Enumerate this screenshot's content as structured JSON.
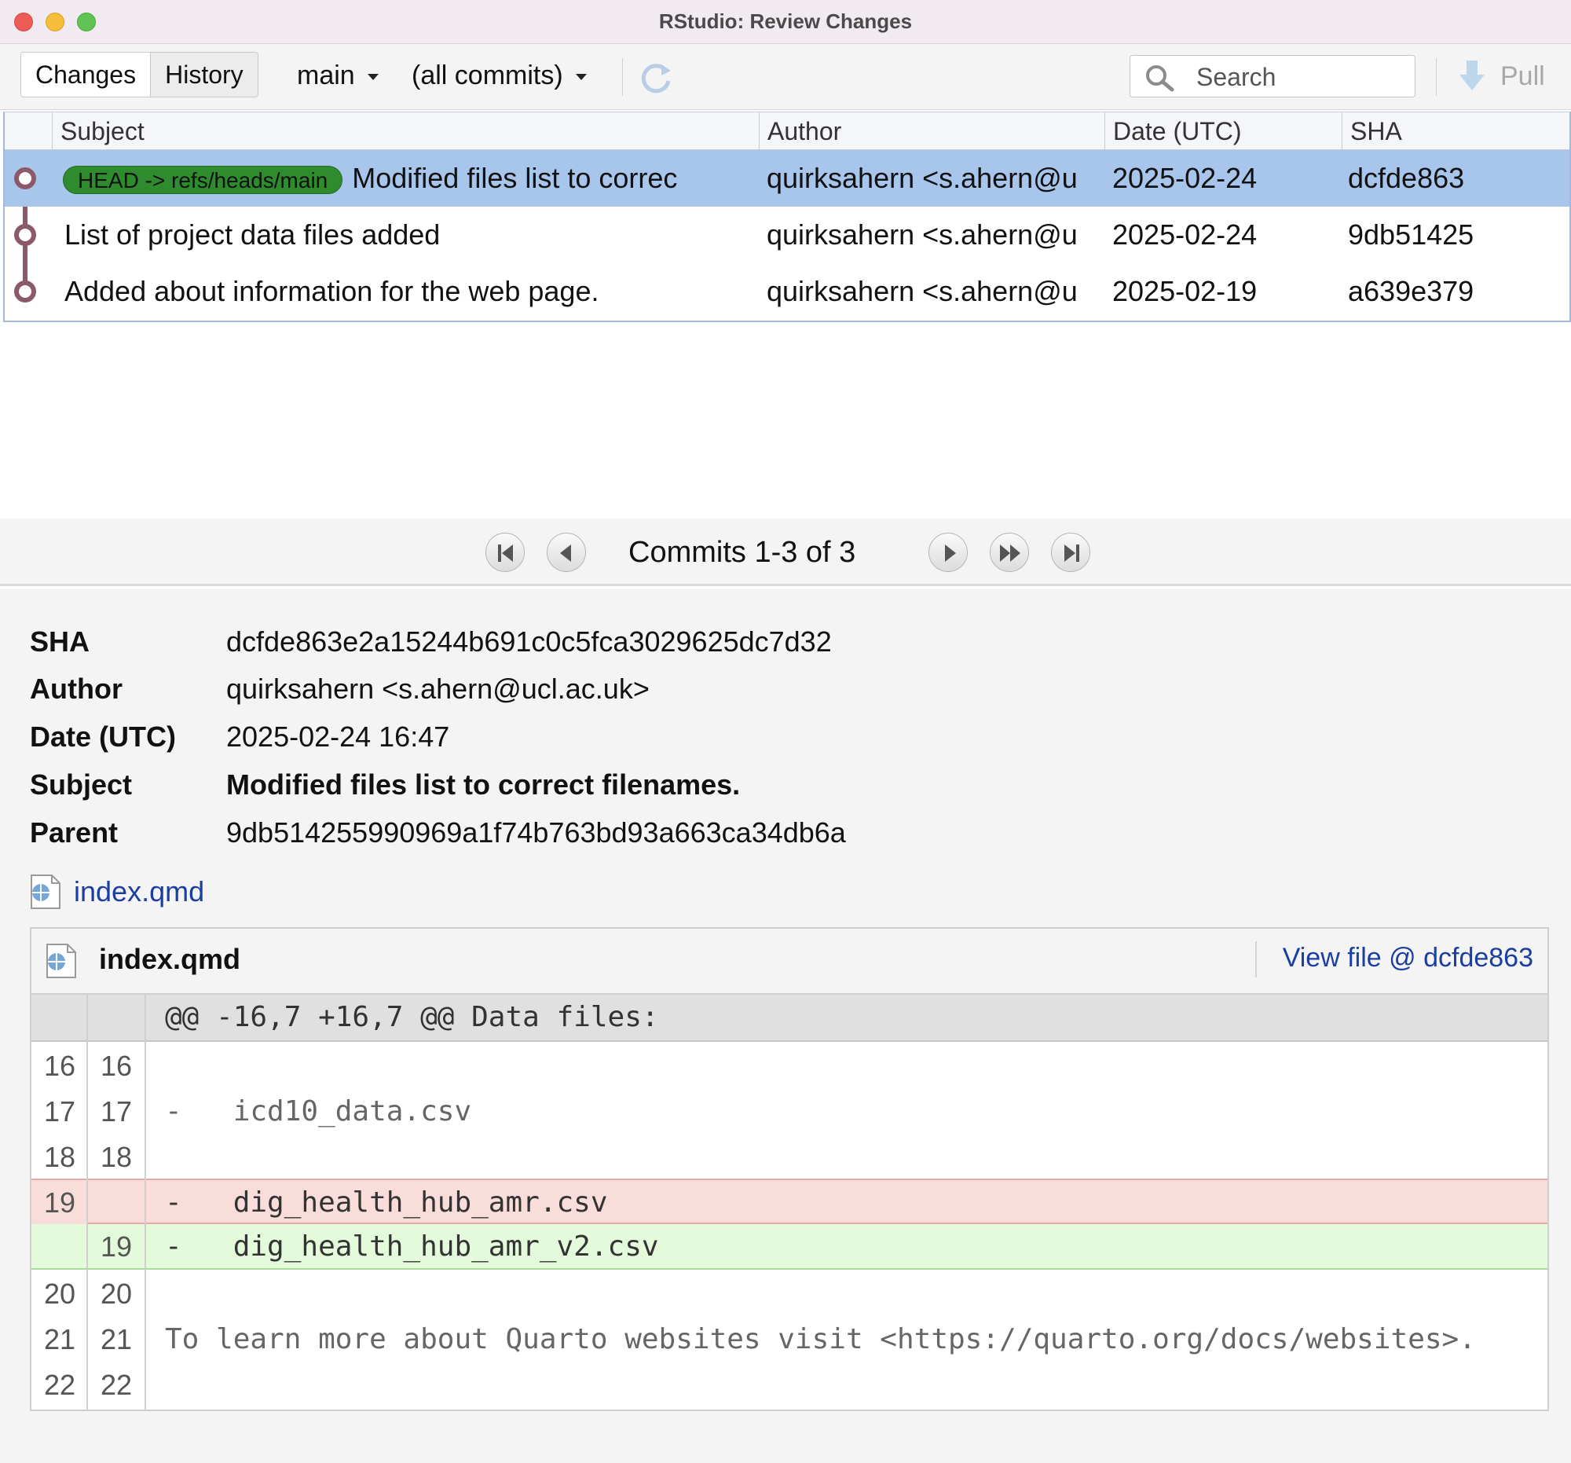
{
  "window": {
    "title": "RStudio: Review Changes"
  },
  "toolbar": {
    "tabs": [
      "Changes",
      "History"
    ],
    "branch": "main",
    "filter": "(all commits)",
    "search_placeholder": "Search",
    "pull_label": "Pull"
  },
  "commit_table": {
    "columns": [
      "Subject",
      "Author",
      "Date (UTC)",
      "SHA"
    ],
    "rows": [
      {
        "ref": "HEAD -> refs/heads/main",
        "subject": "Modified files list to correc",
        "author": "quirksahern <s.ahern@u",
        "date": "2025-02-24",
        "sha": "dcfde863"
      },
      {
        "ref": "",
        "subject": "List of project data files added",
        "author": "quirksahern <s.ahern@u",
        "date": "2025-02-24",
        "sha": "9db51425"
      },
      {
        "ref": "",
        "subject": "Added about information for the web page.",
        "author": "quirksahern <s.ahern@u",
        "date": "2025-02-19",
        "sha": "a639e379"
      }
    ]
  },
  "pager": {
    "label": "Commits 1-3 of 3"
  },
  "details": {
    "labels": {
      "sha": "SHA",
      "author": "Author",
      "date": "Date (UTC)",
      "subject": "Subject",
      "parent": "Parent"
    },
    "sha": "dcfde863e2a15244b691c0c5fca3029625dc7d32",
    "author": "quirksahern <s.ahern@ucl.ac.uk>",
    "date": "2025-02-24 16:47",
    "subject": "Modified files list to correct filenames.",
    "parent": "9db514255990969a1f74b763bd93a663ca34db6a",
    "file_link": "index.qmd"
  },
  "diff": {
    "filename": "index.qmd",
    "view_file": "View file @ dcfde863",
    "hunk_header": "@@ -16,7 +16,7 @@ Data files:",
    "lines": [
      {
        "old": "16",
        "new": "16",
        "text": ""
      },
      {
        "old": "17",
        "new": "17",
        "text": "-   icd10_data.csv"
      },
      {
        "old": "18",
        "new": "18",
        "text": ""
      },
      {
        "old": "19",
        "new": "",
        "text": "-   dig_health_hub_amr.csv"
      },
      {
        "old": "",
        "new": "19",
        "text": "-   dig_health_hub_amr_v2.csv"
      },
      {
        "old": "20",
        "new": "20",
        "text": ""
      },
      {
        "old": "21",
        "new": "21",
        "text": "To learn more about Quarto websites visit <https://quarto.org/docs/websites>."
      },
      {
        "old": "22",
        "new": "22",
        "text": ""
      }
    ]
  },
  "colors": {
    "selected_row": "#a8c5ec",
    "ref_badge": "#2e8b2e",
    "graph": "#8b5a6a",
    "deleted_line": "#f9dddb",
    "added_line": "#e3fadb",
    "link": "#1a3fa0"
  },
  "icons": [
    "refresh-icon",
    "search-icon",
    "pull-arrow-icon",
    "first-page-icon",
    "prev-page-icon",
    "next-page-icon",
    "fast-forward-icon",
    "last-page-icon",
    "qmd-file-icon"
  ]
}
